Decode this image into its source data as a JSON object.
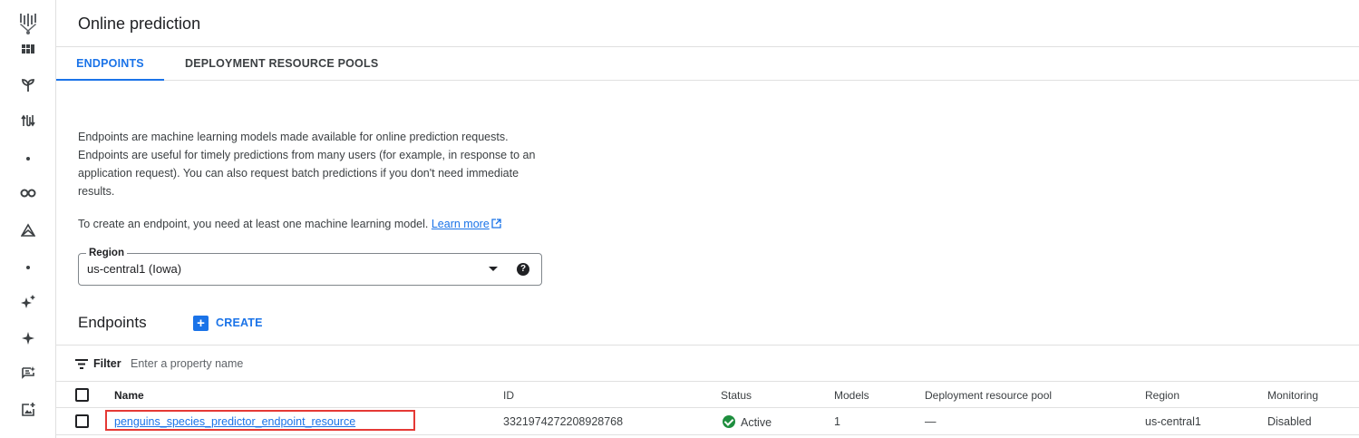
{
  "header": {
    "title": "Online prediction"
  },
  "tabs": [
    {
      "label": "ENDPOINTS",
      "active": true
    },
    {
      "label": "DEPLOYMENT RESOURCE POOLS",
      "active": false
    }
  ],
  "description": {
    "paragraph": "Endpoints are machine learning models made available for online prediction requests. Endpoints are useful for timely predictions from many users (for example, in response to an application request). You can also request batch predictions if you don't need immediate results.",
    "create_note": "To create an endpoint, you need at least one machine learning model.",
    "learn_more": "Learn more"
  },
  "region": {
    "label": "Region",
    "value": "us-central1 (Iowa)"
  },
  "section": {
    "title": "Endpoints",
    "create_label": "CREATE"
  },
  "filter": {
    "label": "Filter",
    "placeholder": "Enter a property name"
  },
  "table": {
    "columns": [
      "Name",
      "ID",
      "Status",
      "Models",
      "Deployment resource pool",
      "Region",
      "Monitoring"
    ],
    "rows": [
      {
        "name": "penguins_species_predictor_endpoint_resource",
        "id": "3321974272208928768",
        "status": "Active",
        "models": "1",
        "pool": "—",
        "region": "us-central1",
        "monitoring": "Disabled"
      }
    ]
  },
  "icons": {
    "rail": [
      "vertex-ai-logo-icon",
      "dashboard-icon",
      "model-garden-icon",
      "pipelines-icon",
      "dot-icon",
      "notebooks-icon",
      "workbench-icon",
      "dot-icon",
      "generative-ai-icon",
      "sparkle-icon",
      "prompt-icon",
      "add-image-icon"
    ],
    "status": "check-circle-icon"
  },
  "colors": {
    "accent": "#1a73e8",
    "active": "#1e8e3e",
    "highlight": "#e53935"
  }
}
